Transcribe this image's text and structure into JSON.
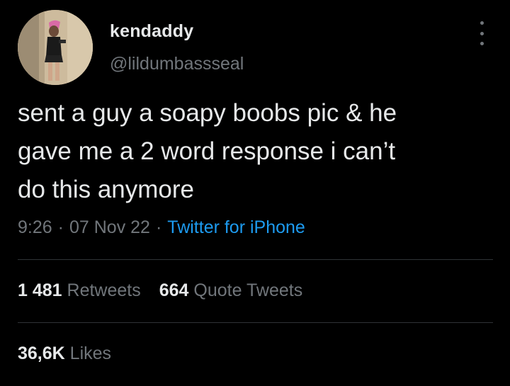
{
  "user": {
    "display_name": "kendaddy",
    "handle": "@lildumbassseal"
  },
  "tweet": {
    "text": "sent a guy a soapy boobs pic & he\ngave me a 2 word response i can’t\ndo this anymore",
    "time": "9:26",
    "date": "07 Nov 22",
    "separator": "·",
    "source": "Twitter for iPhone"
  },
  "stats": {
    "retweets_count": "1 481",
    "retweets_label": "Retweets",
    "quotes_count": "664",
    "quotes_label": "Quote Tweets",
    "likes_count": "36,6K",
    "likes_label": "Likes"
  },
  "colors": {
    "background": "#000000",
    "primary_text": "#e7e9ea",
    "secondary_text": "#71767b",
    "link": "#1d9bf0",
    "divider": "#2f3336"
  },
  "icons": {
    "more": "more-vertical-icon"
  }
}
